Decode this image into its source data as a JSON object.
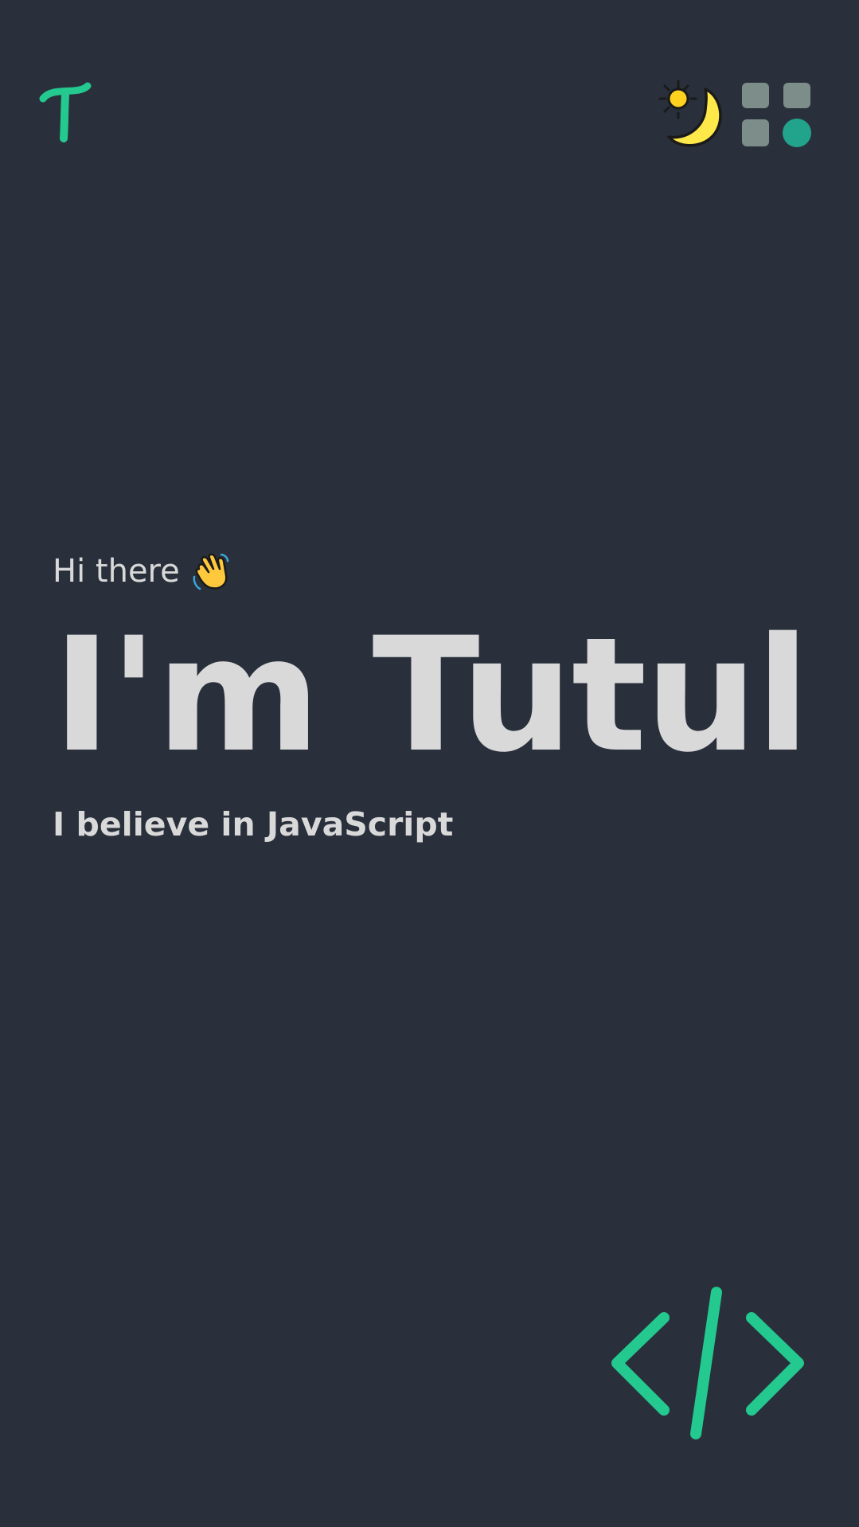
{
  "header": {
    "logo_icon": "tutul-t-logo-icon",
    "theme_toggle_icon": "sun-moon-icon",
    "menu_icon": "app-grid-menu-icon"
  },
  "hero": {
    "greeting": "Hi there",
    "greeting_icon": "waving-hand-icon",
    "name": "I'm Tutul",
    "tagline": "I believe in JavaScript"
  },
  "decor": {
    "code_icon": "code-brackets-icon"
  },
  "colors": {
    "background": "#29303b",
    "accent": "#23c98e",
    "text": "#d9d9d9",
    "menu_tile": "#7d8d8a",
    "menu_dot": "#22a38b",
    "sun": "#ffd21f",
    "moon": "#ffe84a"
  }
}
